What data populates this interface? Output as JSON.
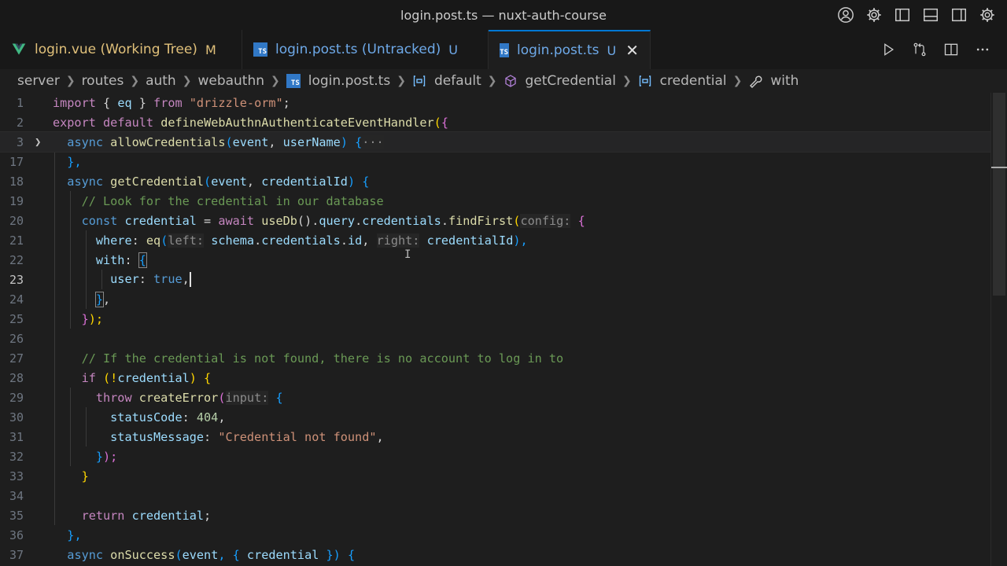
{
  "window": {
    "title": "login.post.ts — nuxt-auth-course"
  },
  "title_actions": [
    "account-icon",
    "settings-gear-icon",
    "toggle-primary-sidebar-icon",
    "toggle-panel-icon",
    "toggle-secondary-sidebar-icon",
    "manage-gear-icon"
  ],
  "tabs": [
    {
      "label": "login.vue (Working Tree)",
      "status": "M",
      "icon": "vue-icon",
      "active": false
    },
    {
      "label": "login.post.ts (Untracked)",
      "status": "U",
      "icon": "ts-icon",
      "active": false
    },
    {
      "label": "login.post.ts",
      "status": "U",
      "icon": "ts-icon",
      "active": true
    }
  ],
  "tab_actions": [
    "run-icon",
    "compare-changes-icon",
    "split-editor-icon",
    "more-actions-icon"
  ],
  "breadcrumb": {
    "items": [
      "server",
      "routes",
      "auth",
      "webauthn",
      "login.post.ts",
      "default",
      "getCredential",
      "credential",
      "with"
    ],
    "ts_badge": "TS"
  },
  "editor": {
    "line_numbers": [
      "1",
      "2",
      "3",
      "17",
      "18",
      "19",
      "20",
      "21",
      "22",
      "23",
      "24",
      "25",
      "26",
      "27",
      "28",
      "29",
      "30",
      "31",
      "32",
      "33",
      "34",
      "35",
      "36",
      "37"
    ],
    "active_line": "23",
    "tokens": {
      "l1": [
        "import",
        " { ",
        "eq",
        " } ",
        "from",
        " ",
        "\"drizzle-orm\"",
        ";"
      ],
      "l2": [
        "export",
        " ",
        "default",
        " ",
        "defineWebAuthnAuthenticateEventHandler",
        "(",
        "{"
      ],
      "l3": [
        "async",
        " ",
        "allowCredentials",
        "(",
        "event",
        ", ",
        "userName",
        ") ",
        "{",
        "···"
      ],
      "l17": [
        "},"
      ],
      "l18": [
        "async",
        " ",
        "getCredential",
        "(",
        "event",
        ", ",
        "credentialId",
        ") ",
        "{"
      ],
      "l19": [
        "// Look for the credential in our database"
      ],
      "l20": [
        "const",
        " ",
        "credential",
        " = ",
        "await",
        " ",
        "useDb",
        "().",
        "query",
        ".",
        "credentials",
        ".",
        "findFirst",
        "(",
        "config:",
        " ",
        "{"
      ],
      "l21": [
        "where",
        ": ",
        "eq",
        "(",
        "left:",
        " ",
        "schema",
        ".",
        "credentials",
        ".",
        "id",
        ", ",
        "right:",
        " ",
        "credentialId",
        "),"
      ],
      "l22": [
        "with",
        ": ",
        "{"
      ],
      "l23": [
        "user",
        ": ",
        "true",
        ","
      ],
      "l24": [
        "}",
        ","
      ],
      "l25": [
        "}",
        ");"
      ],
      "l27": [
        "// If the credential is not found, there is no account to log in to"
      ],
      "l28": [
        "if",
        " (!",
        "credential",
        ") ",
        "{"
      ],
      "l29": [
        "throw",
        " ",
        "createError",
        "(",
        "input:",
        " ",
        "{"
      ],
      "l30": [
        "statusCode",
        ": ",
        "404",
        ","
      ],
      "l31": [
        "statusMessage",
        ": ",
        "\"Credential not found\"",
        ","
      ],
      "l32": [
        "}",
        ");"
      ],
      "l33": [
        "}"
      ],
      "l35": [
        "return",
        " ",
        "credential",
        ";"
      ],
      "l36": [
        "},"
      ],
      "l37": [
        "async",
        " ",
        "onSuccess",
        "(",
        "event",
        ", { ",
        "credential",
        " }) ",
        "{"
      ]
    }
  },
  "colors": {
    "keyword": "#c586c0",
    "storage": "#569cd6",
    "function": "#dcdcaa",
    "variable": "#9cdcfe",
    "string": "#ce9178",
    "comment": "#6a9955",
    "number": "#b5cea8",
    "accent": "#0078d4"
  }
}
